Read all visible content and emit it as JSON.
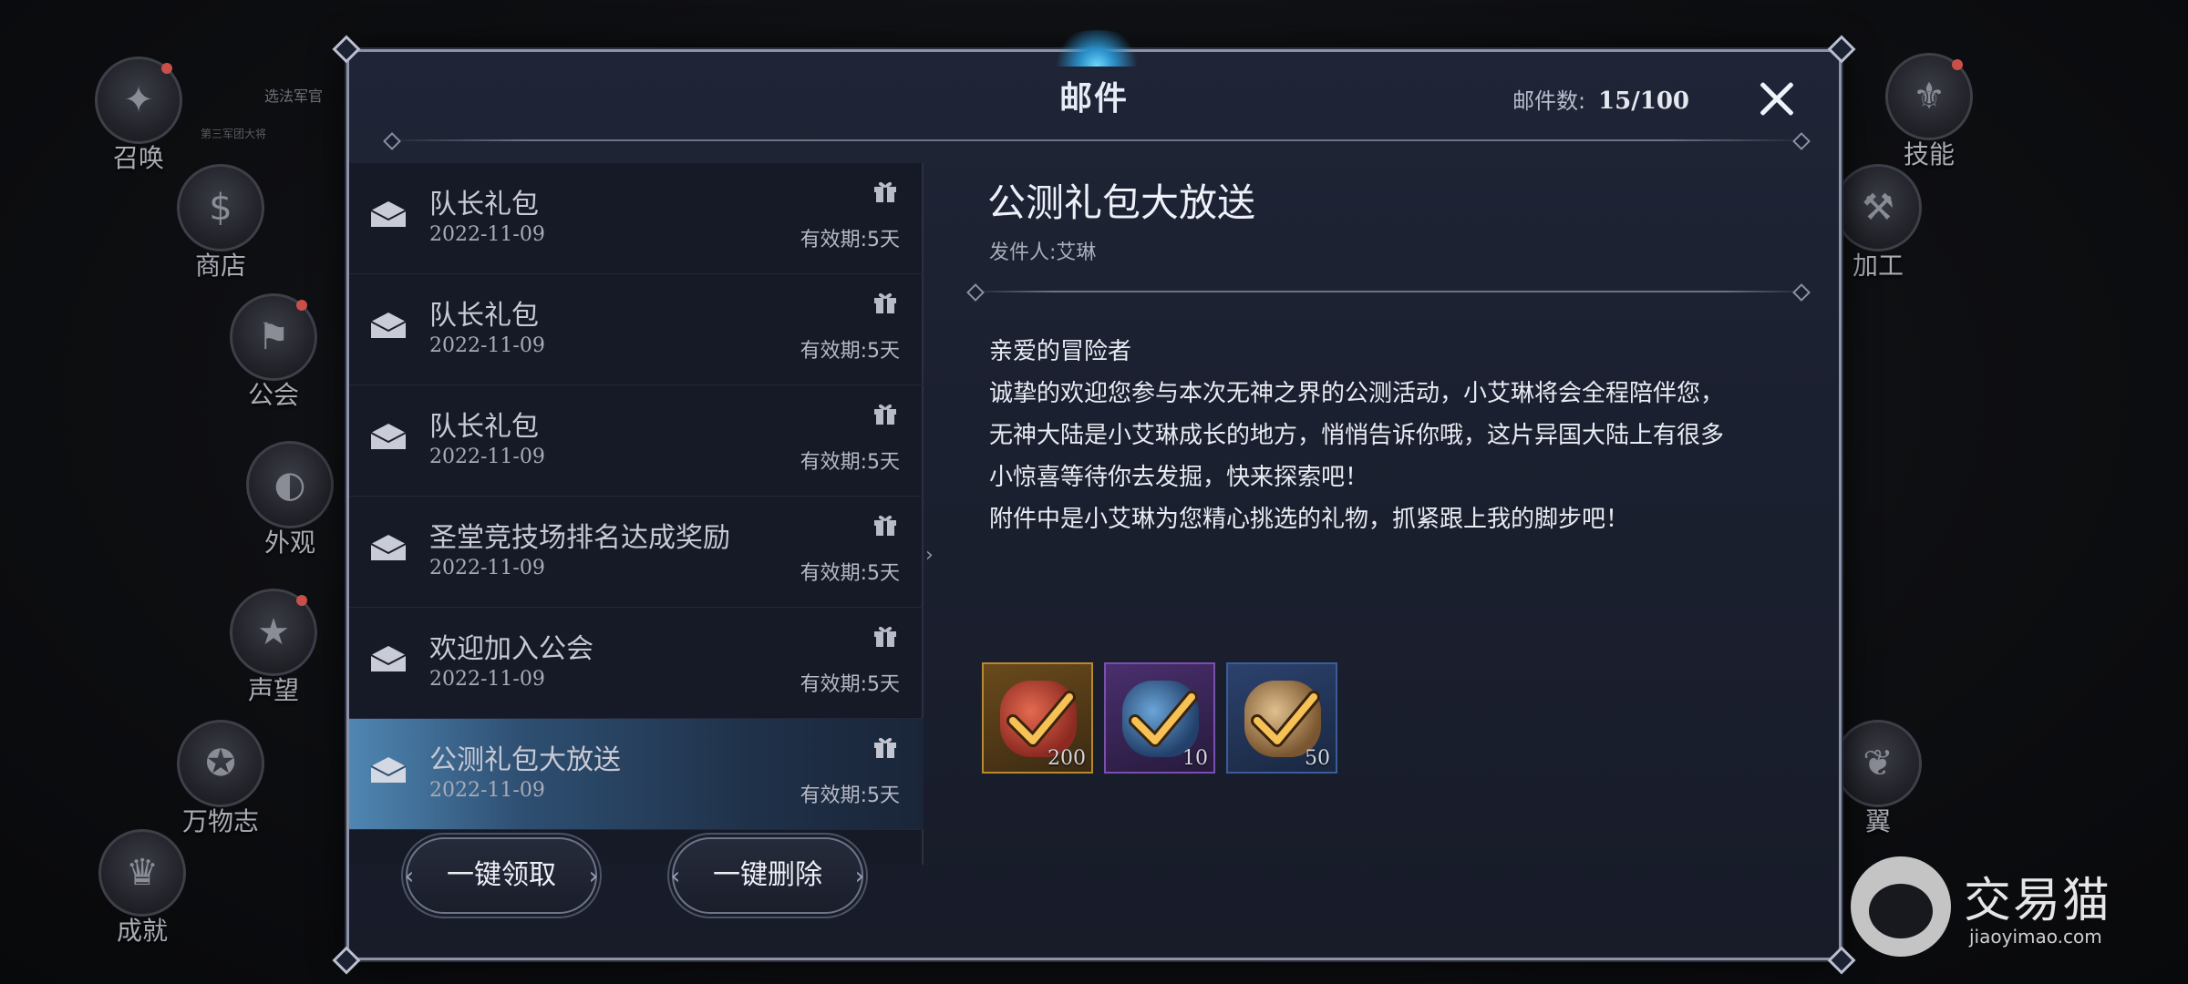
{
  "side_menu": {
    "left": [
      {
        "label": "召唤",
        "icon": "summon-icon"
      },
      {
        "label": "商店",
        "icon": "shop-icon"
      },
      {
        "label": "公会",
        "icon": "guild-icon"
      },
      {
        "label": "外观",
        "icon": "appearance-icon"
      },
      {
        "label": "声望",
        "icon": "reputation-icon"
      },
      {
        "label": "万物志",
        "icon": "codex-icon"
      },
      {
        "label": "成就",
        "icon": "achievement-icon"
      }
    ],
    "right": [
      {
        "label": "技能",
        "icon": "skill-icon"
      },
      {
        "label": "加工",
        "icon": "craft-icon"
      },
      {
        "label": "翼",
        "icon": "wings-icon"
      }
    ],
    "bg_text": [
      "选法军官",
      "第三军团大将"
    ]
  },
  "modal": {
    "title": "邮件",
    "mail_count_label": "邮件数:",
    "mail_count_value": "15/100"
  },
  "mail_list": [
    {
      "title": "队长礼包",
      "date": "2022-11-09",
      "validity": "有效期:5天",
      "selected": false
    },
    {
      "title": "队长礼包",
      "date": "2022-11-09",
      "validity": "有效期:5天",
      "selected": false
    },
    {
      "title": "队长礼包",
      "date": "2022-11-09",
      "validity": "有效期:5天",
      "selected": false
    },
    {
      "title": "圣堂竞技场排名达成奖励",
      "date": "2022-11-09",
      "validity": "有效期:5天",
      "selected": false
    },
    {
      "title": "欢迎加入公会",
      "date": "2022-11-09",
      "validity": "有效期:5天",
      "selected": false
    },
    {
      "title": "公测礼包大放送",
      "date": "2022-11-09",
      "validity": "有效期:5天",
      "selected": true
    }
  ],
  "list_buttons": {
    "claim_all": "一键领取",
    "delete_all": "一键删除"
  },
  "detail": {
    "title": "公测礼包大放送",
    "sender": "发件人:艾琳",
    "body": [
      "亲爱的冒险者",
      "诚挚的欢迎您参与本次无神之界的公测活动，小艾琳将会全程陪伴您，",
      "无神大陆是小艾琳成长的地方，悄悄告诉你哦，这片异国大陆上有很多",
      "小惊喜等待你去发掘，快来探索吧！",
      "附件中是小艾琳为您精心挑选的礼物，抓紧跟上我的脚步吧！"
    ],
    "attachments": [
      {
        "qty": "200",
        "rarity_color": "#b8892e",
        "item_color": "#c8453a",
        "claimed": true
      },
      {
        "qty": "10",
        "rarity_color": "#7a4fb0",
        "item_color": "#3c6ea8",
        "claimed": true
      },
      {
        "qty": "50",
        "rarity_color": "#3b5c9a",
        "item_color": "#b58a57",
        "claimed": true
      }
    ]
  },
  "watermark": {
    "brand": "交易猫",
    "url": "jiaoyimao.com"
  },
  "colors": {
    "accent_blue": "#4f86b2",
    "check_gold": "#f2b34a"
  }
}
